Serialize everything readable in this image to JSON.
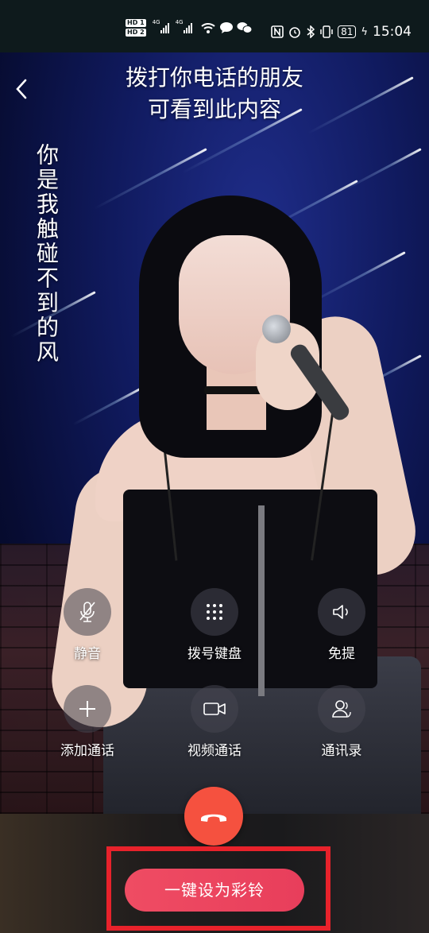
{
  "status_bar": {
    "hd1": "HD 1",
    "hd2": "HD 2",
    "signal1_label": "4G",
    "signal2_label": "4G",
    "battery": "81",
    "time": "15:04"
  },
  "header": {
    "notice_line1": "拨打你电话的朋友",
    "notice_line2": "可看到此内容"
  },
  "video": {
    "lyric": "你是我触碰不到的风"
  },
  "controls": {
    "mute": "静音",
    "dialpad": "拨号键盘",
    "speaker": "免提",
    "add_call": "添加通话",
    "video_call": "视频通话",
    "contacts": "通讯录"
  },
  "bottom": {
    "set_ringtone": "一键设为彩铃"
  },
  "colors": {
    "hangup": "#f5513f",
    "ringtone_button": "#ef4c63",
    "highlight_border": "#e8222b"
  }
}
